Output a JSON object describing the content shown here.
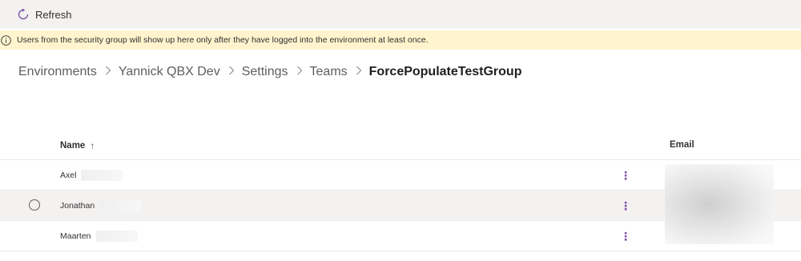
{
  "toolbar": {
    "refresh_label": "Refresh",
    "refresh_icon": "refresh-icon"
  },
  "notice": {
    "icon": "info-icon",
    "text": "Users from the security group will show up here only after they have logged into the environment at least once."
  },
  "breadcrumb": {
    "items": [
      "Environments",
      "Yannick QBX Dev",
      "Settings",
      "Teams"
    ],
    "current": "ForcePopulateTestGroup",
    "separator": ">"
  },
  "table": {
    "columns": {
      "name": "Name",
      "name_sort_icon": "↑",
      "email": "Email"
    },
    "rows": [
      {
        "name": "Axel",
        "selected": false
      },
      {
        "name": "Jonathan",
        "selected": false,
        "hovered": true
      },
      {
        "name": "Maarten",
        "selected": false
      }
    ],
    "more_icon": "⋮"
  },
  "colors": {
    "toolbar_bg": "#f3f2f1",
    "notice_bg": "#fff4ce",
    "accent": "#7a4fa5"
  }
}
